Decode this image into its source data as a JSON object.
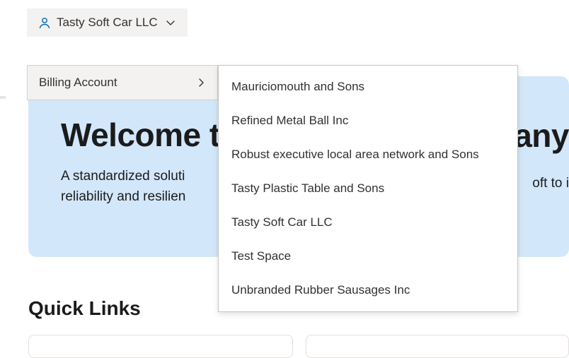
{
  "account": {
    "selected": "Tasty Soft Car LLC",
    "submenu_label": "Billing Account"
  },
  "welcome": {
    "title_visible_left": "Welcome t",
    "title_visible_right": "fany",
    "subtitle_line1": "A standardized soluti",
    "subtitle_line2": "reliability and resilien",
    "subtitle_right": "oft to i"
  },
  "quick_links": {
    "heading": "Quick Links"
  },
  "dropdown": {
    "items": [
      "Mauriciomouth and Sons",
      "Refined Metal Ball Inc",
      "Robust executive local area network and Sons",
      "Tasty Plastic Table and Sons",
      "Tasty Soft Car LLC",
      "Test Space",
      "Unbranded Rubber Sausages Inc"
    ]
  }
}
